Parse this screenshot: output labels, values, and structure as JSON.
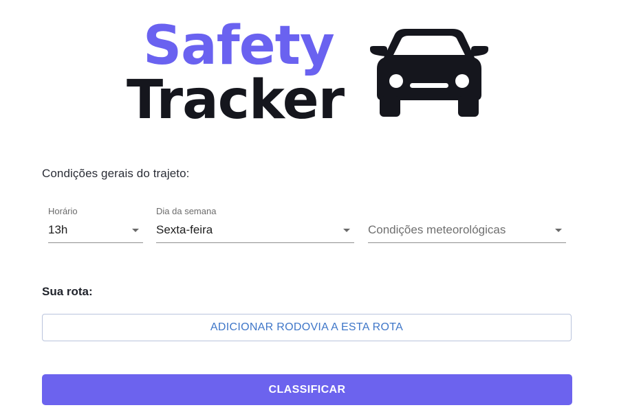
{
  "logo": {
    "line1": "Safety",
    "line2": "Tracker",
    "icon": "car-icon"
  },
  "colors": {
    "brand_purple": "#6a62f0",
    "logo_dark": "#15161d",
    "link_blue": "#3e76c8",
    "button_purple": "#6c63ee"
  },
  "conditions": {
    "title": "Condições gerais do trajeto:",
    "fields": {
      "horario": {
        "label": "Horário",
        "value": "13h",
        "icon": "chevron-down-icon"
      },
      "dia": {
        "label": "Dia da semana",
        "value": "Sexta-feira",
        "icon": "chevron-down-icon"
      },
      "clima": {
        "placeholder": "Condições meteorológicas",
        "icon": "chevron-down-icon"
      }
    }
  },
  "route": {
    "title": "Sua rota:",
    "add_button": "ADICIONAR RODOVIA A ESTA ROTA"
  },
  "actions": {
    "classify": "CLASSIFICAR"
  }
}
